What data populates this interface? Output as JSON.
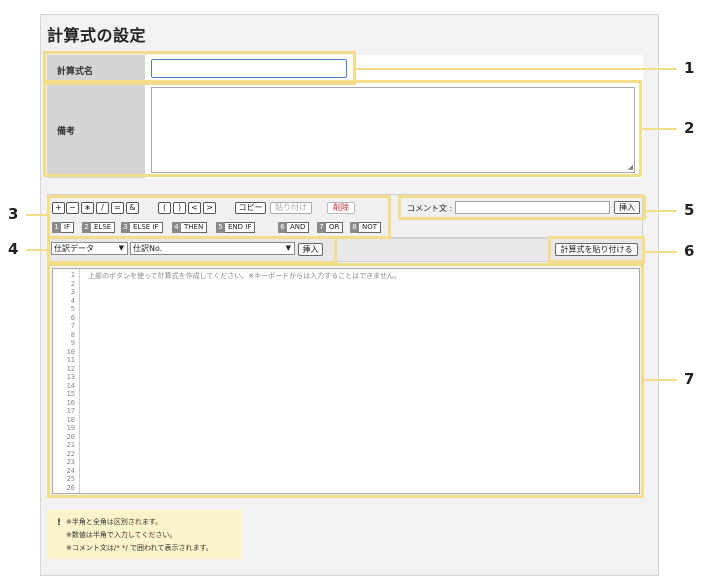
{
  "page": {
    "title": "計算式の設定"
  },
  "form": {
    "name_label": "計算式名",
    "name_value": "",
    "remarks_label": "備考",
    "remarks_value": ""
  },
  "toolbar": {
    "operators": [
      "+",
      "−",
      "∗",
      "/",
      "=",
      "&"
    ],
    "parens": [
      "(",
      ")",
      "<",
      ">"
    ],
    "copy_label": "コピー",
    "paste_label": "貼り付け",
    "delete_label": "削除",
    "keywords": [
      {
        "num": "1",
        "label": "IF"
      },
      {
        "num": "2",
        "label": "ELSE"
      },
      {
        "num": "3",
        "label": "ELSE IF"
      },
      {
        "num": "4",
        "label": "THEN"
      },
      {
        "num": "5",
        "label": "END IF"
      },
      {
        "num": "6",
        "label": "AND"
      },
      {
        "num": "7",
        "label": "OR"
      },
      {
        "num": "8",
        "label": "NOT"
      }
    ]
  },
  "comment": {
    "label": "コメント文 :",
    "value": "",
    "insert_label": "挿入"
  },
  "selectors": {
    "category_value": "仕訳データ",
    "field_value": "仕訳No.",
    "insert_label": "挿入",
    "paste_formula_label": "計算式を貼り付ける"
  },
  "editor": {
    "hint": "上部のボタンを使って計算式を作成してください。※キーボードからは入力することはできません。",
    "line_numbers": [
      "1",
      "2",
      "3",
      "4",
      "5",
      "6",
      "7",
      "8",
      "9",
      "10",
      "11",
      "12",
      "13",
      "14",
      "15",
      "16",
      "17",
      "18",
      "19",
      "20",
      "21",
      "22",
      "23",
      "24",
      "25",
      "26"
    ]
  },
  "notes": {
    "mark": "!",
    "lines": [
      "※半角と全角は区別されます。",
      "※数値は半角で入力してください。",
      "※コメント文は/* */ で囲われて表示されます。"
    ]
  },
  "callouts": [
    "1",
    "2",
    "3",
    "4",
    "5",
    "6",
    "7"
  ],
  "colors": {
    "highlight": "#f3dc8a",
    "input_focus": "#4a7fc9",
    "delete_red": "#c1272d",
    "note_bg": "#fbf3c9"
  }
}
